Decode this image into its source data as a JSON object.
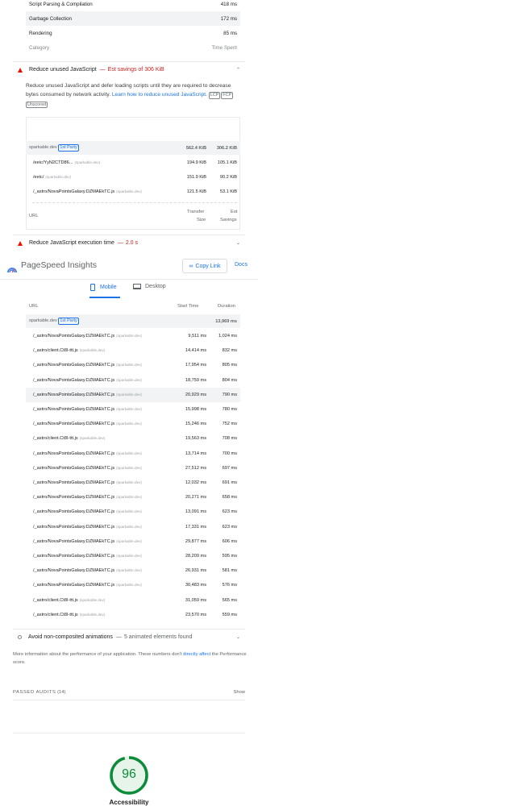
{
  "top_table": {
    "rows": [
      {
        "label": "Script Parsing & Compilation",
        "value": "418 ms"
      },
      {
        "label": "Garbage Collection",
        "value": "172 ms"
      },
      {
        "label": "Rendering",
        "value": "85 ms"
      }
    ],
    "footer_left": "Category",
    "footer_right": "Time Spent"
  },
  "unused_js": {
    "title": "Reduce unused JavaScript",
    "dash": "—",
    "savings": "Est savings of 306 KiB",
    "desc_text": "Reduce unused JavaScript and defer loading scripts until they are required to decrease bytes consumed by network activity. ",
    "desc_link": "Learn how to reduce unused JavaScript",
    "chips": [
      "LCP",
      "FCP",
      "Unscored"
    ],
    "group": {
      "label": "sparkable.dev",
      "badge": "1st Party",
      "transfer": "562.4 KiB",
      "savings": "306.2 KiB"
    },
    "rows": [
      {
        "url": "/eeic/YyN2CTD86...",
        "src": "(sparkable.dev)",
        "transfer": "194.9 KiB",
        "savings": "105.1 KiB"
      },
      {
        "url": "/eeic/",
        "src": "(sparkable.dev)",
        "transfer": "151.9 KiB",
        "savings": "90.2 KiB"
      },
      {
        "url": "/_astro/NovaPointsGalaxy.DZMAEkTC.js",
        "src": "(sparkable.dev)",
        "transfer": "121.5 KiB",
        "savings": "53.1 KiB"
      }
    ],
    "col_url": "URL",
    "col_transfer_1": "Transfer",
    "col_transfer_2": "Size",
    "col_savings_1": "Est",
    "col_savings_2": "Savings"
  },
  "exec_time": {
    "title": "Reduce JavaScript execution time",
    "dash": "—",
    "value": "2.0 s"
  },
  "header": {
    "title": "PageSpeed Insights",
    "copy_link": "Copy Link",
    "docs": "Docs",
    "tab_mobile": "Mobile",
    "tab_desktop": "Desktop"
  },
  "threads": {
    "col_url": "URL",
    "col_start": "Start Time",
    "col_duration": "Duration",
    "group": {
      "label": "sparkable.dev",
      "badge": "1st Party",
      "duration": "13,969 ms"
    },
    "rows": [
      {
        "url": "/_astro/NovaPointsGalaxy.DZMAEkTC.js",
        "src": "(sparkable.dev)",
        "start": "9,511 ms",
        "dur": "1,024 ms"
      },
      {
        "url": "/_astro/client.Ct8I-ttt.js",
        "src": "(sparkable.dev)",
        "start": "14,414 ms",
        "dur": "832 ms"
      },
      {
        "url": "/_astro/NovaPointsGalaxy.DZMAEkTC.js",
        "src": "(sparkable.dev)",
        "start": "17,954 ms",
        "dur": "805 ms"
      },
      {
        "url": "/_astro/NovaPointsGalaxy.DZMAEkTC.js",
        "src": "(sparkable.dev)",
        "start": "18,759 ms",
        "dur": "804 ms"
      },
      {
        "url": "/_astro/NovaPointsGalaxy.DZMAEkTC.js",
        "src": "(sparkable.dev)",
        "start": "20,929 ms",
        "dur": "790 ms"
      },
      {
        "url": "/_astro/NovaPointsGalaxy.DZMAEkTC.js",
        "src": "(sparkable.dev)",
        "start": "15,998 ms",
        "dur": "780 ms"
      },
      {
        "url": "/_astro/NovaPointsGalaxy.DZMAEkTC.js",
        "src": "(sparkable.dev)",
        "start": "15,246 ms",
        "dur": "752 ms"
      },
      {
        "url": "/_astro/client.Ct8I-ttt.js",
        "src": "(sparkable.dev)",
        "start": "19,563 ms",
        "dur": "708 ms"
      },
      {
        "url": "/_astro/NovaPointsGalaxy.DZMAEkTC.js",
        "src": "(sparkable.dev)",
        "start": "13,714 ms",
        "dur": "700 ms"
      },
      {
        "url": "/_astro/NovaPointsGalaxy.DZMAEkTC.js",
        "src": "(sparkable.dev)",
        "start": "27,512 ms",
        "dur": "697 ms"
      },
      {
        "url": "/_astro/NovaPointsGalaxy.DZMAEkTC.js",
        "src": "(sparkable.dev)",
        "start": "12,032 ms",
        "dur": "691 ms"
      },
      {
        "url": "/_astro/NovaPointsGalaxy.DZMAEkTC.js",
        "src": "(sparkable.dev)",
        "start": "20,271 ms",
        "dur": "658 ms"
      },
      {
        "url": "/_astro/NovaPointsGalaxy.DZMAEkTC.js",
        "src": "(sparkable.dev)",
        "start": "13,091 ms",
        "dur": "623 ms"
      },
      {
        "url": "/_astro/NovaPointsGalaxy.DZMAEkTC.js",
        "src": "(sparkable.dev)",
        "start": "17,331 ms",
        "dur": "623 ms"
      },
      {
        "url": "/_astro/NovaPointsGalaxy.DZMAEkTC.js",
        "src": "(sparkable.dev)",
        "start": "29,877 ms",
        "dur": "606 ms"
      },
      {
        "url": "/_astro/NovaPointsGalaxy.DZMAEkTC.js",
        "src": "(sparkable.dev)",
        "start": "28,209 ms",
        "dur": "595 ms"
      },
      {
        "url": "/_astro/NovaPointsGalaxy.DZMAEkTC.js",
        "src": "(sparkable.dev)",
        "start": "26,931 ms",
        "dur": "581 ms"
      },
      {
        "url": "/_astro/NovaPointsGalaxy.DZMAEkTC.js",
        "src": "(sparkable.dev)",
        "start": "30,483 ms",
        "dur": "576 ms"
      },
      {
        "url": "/_astro/client.Ct8I-ttt.js",
        "src": "(sparkable.dev)",
        "start": "31,059 ms",
        "dur": "565 ms"
      },
      {
        "url": "/_astro/client.Ct8I-ttt.js",
        "src": "(sparkable.dev)",
        "start": "23,570 ms",
        "dur": "559 ms"
      }
    ]
  },
  "animations": {
    "title": "Avoid non-composited animations",
    "dash": "—",
    "value": "5 animated elements found"
  },
  "perf_note": {
    "text": "More information about the performance of your application. These numbers don't ",
    "link": "directly affect",
    "text2": " the Performance score."
  },
  "passed": {
    "label": "PASSED AUDITS",
    "count": "(14)",
    "show": "Show"
  },
  "accessibility": {
    "score": "96",
    "score_fraction": 0.96,
    "label": "Accessibility",
    "color": "#0c8b3a"
  },
  "colors": {
    "fail": "#eb0f00",
    "link": "#1a73e8",
    "pass": "#0c8b3a"
  }
}
